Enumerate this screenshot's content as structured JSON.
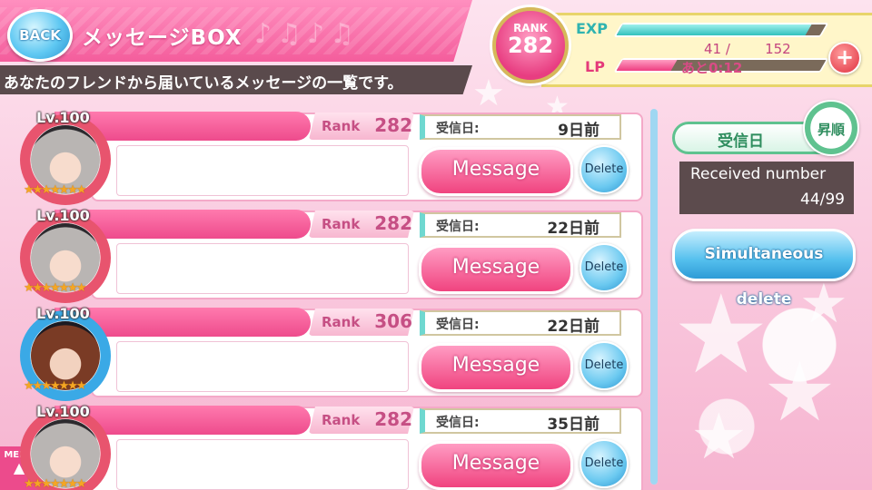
{
  "header": {
    "back_label": "BACK",
    "title": "メッセージBOX",
    "subtitle": "あなたのフレンドから届いているメッセージの一覧です。"
  },
  "status": {
    "rank_label": "RANK",
    "rank_value": "282",
    "exp_label": "EXP",
    "exp_fraction": 0.93,
    "lp_label": "LP",
    "lp_current": "41 /",
    "lp_max": "152",
    "lp_fraction": 0.27,
    "lp_timer": "あと0:12",
    "plus_label": "+"
  },
  "messages": [
    {
      "level": "Lv.100",
      "rank_label": "Rank",
      "rank": "282",
      "date_label": "受信日:",
      "date": "9日前",
      "message_label": "Message",
      "delete_label": "Delete",
      "frame": "red"
    },
    {
      "level": "Lv.100",
      "rank_label": "Rank",
      "rank": "282",
      "date_label": "受信日:",
      "date": "22日前",
      "message_label": "Message",
      "delete_label": "Delete",
      "frame": "red"
    },
    {
      "level": "Lv.100",
      "rank_label": "Rank",
      "rank": "306",
      "date_label": "受信日:",
      "date": "22日前",
      "message_label": "Message",
      "delete_label": "Delete",
      "frame": "blue"
    },
    {
      "level": "Lv.100",
      "rank_label": "Rank",
      "rank": "282",
      "date_label": "受信日:",
      "date": "35日前",
      "message_label": "Message",
      "delete_label": "Delete",
      "frame": "red"
    }
  ],
  "sidebar": {
    "sort_field": "受信日",
    "sort_order": "昇順",
    "received_label": "Received number",
    "received_count": "44/99",
    "simultaneous_delete": "Simultaneous delete"
  },
  "menu": {
    "label": "MENU"
  },
  "colors": {
    "accent": "#f0437f",
    "blue": "#55c0ee",
    "green": "#5fc28f"
  }
}
